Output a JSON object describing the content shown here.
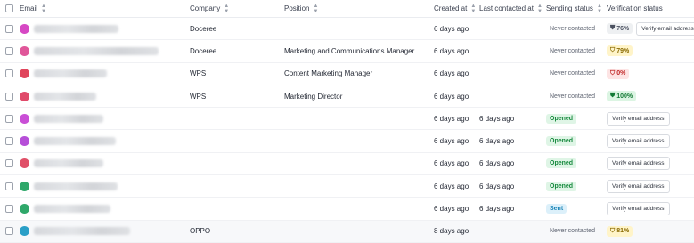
{
  "colors": {
    "accent_green": "#178a3e",
    "accent_blue": "#1d86b8",
    "border": "#eaecf0"
  },
  "header": {
    "email": "Email",
    "company": "Company",
    "position": "Position",
    "created_at": "Created at",
    "last_contacted_at": "Last contacted at",
    "sending_status": "Sending status",
    "verification_status": "Verification status"
  },
  "rows": [
    {
      "avatar_color": "#d648c4",
      "company": "Doceree",
      "position": "",
      "created": "6 days ago",
      "last_contacted": "",
      "sending": "Never contacted",
      "verif_badge": "76%",
      "verif_icon": "neutral-shield-icon",
      "verif_button": "Verify email address"
    },
    {
      "avatar_color": "#e0579a",
      "company": "Doceree",
      "position": "Marketing and Communications Manager",
      "created": "6 days ago",
      "last_contacted": "",
      "sending": "Never contacted",
      "verif_badge": "79%",
      "verif_icon": "warning-shield-icon",
      "verif_button": ""
    },
    {
      "avatar_color": "#e0455c",
      "company": "WPS",
      "position": "Content Marketing Manager",
      "created": "6 days ago",
      "last_contacted": "",
      "sending": "Never contacted",
      "verif_badge": "0%",
      "verif_icon": "invalid-shield-icon",
      "verif_button": ""
    },
    {
      "avatar_color": "#e04a6a",
      "company": "WPS",
      "position": "Marketing Director",
      "created": "6 days ago",
      "last_contacted": "",
      "sending": "Never contacted",
      "verif_badge": "100%",
      "verif_icon": "verified-shield-icon",
      "verif_button": ""
    },
    {
      "avatar_color": "#c94fd6",
      "company": "",
      "position": "",
      "created": "6 days ago",
      "last_contacted": "6 days ago",
      "sending": "Opened",
      "verif_badge": "",
      "verif_icon": "",
      "verif_button": "Verify email address"
    },
    {
      "avatar_color": "#b64fd8",
      "company": "",
      "position": "",
      "created": "6 days ago",
      "last_contacted": "6 days ago",
      "sending": "Opened",
      "verif_badge": "",
      "verif_icon": "",
      "verif_button": "Verify email address"
    },
    {
      "avatar_color": "#e05068",
      "company": "",
      "position": "",
      "created": "6 days ago",
      "last_contacted": "6 days ago",
      "sending": "Opened",
      "verif_badge": "",
      "verif_icon": "",
      "verif_button": "Verify email address"
    },
    {
      "avatar_color": "#2fa86a",
      "company": "",
      "position": "",
      "created": "6 days ago",
      "last_contacted": "6 days ago",
      "sending": "Opened",
      "verif_badge": "",
      "verif_icon": "",
      "verif_button": "Verify email address"
    },
    {
      "avatar_color": "#2fa86a",
      "company": "",
      "position": "",
      "created": "6 days ago",
      "last_contacted": "6 days ago",
      "sending": "Sent",
      "verif_badge": "",
      "verif_icon": "",
      "verif_button": "Verify email address"
    },
    {
      "avatar_color": "#2a9fc7",
      "company": "OPPO",
      "position": "",
      "created": "8 days ago",
      "last_contacted": "",
      "sending": "Never contacted",
      "verif_badge": "81%",
      "verif_icon": "warning-shield-icon",
      "verif_button": ""
    }
  ]
}
